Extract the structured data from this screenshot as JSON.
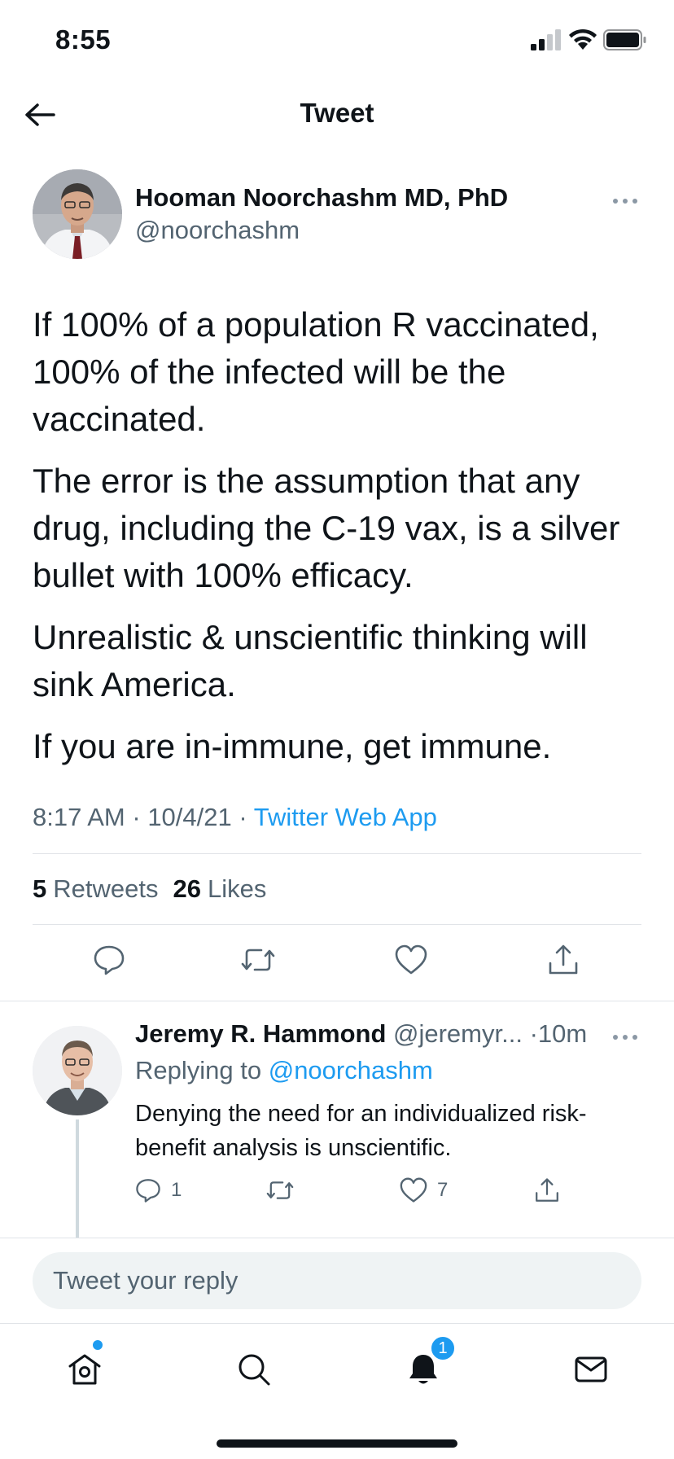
{
  "status_bar": {
    "time": "8:55"
  },
  "nav": {
    "title": "Tweet"
  },
  "tweet": {
    "author_name": "Hooman Noorchashm MD, PhD",
    "author_handle": "@noorchashm",
    "paragraphs": [
      "If 100% of a population R vaccinated, 100% of the infected will be the vaccinated.",
      "The error is the assumption that any drug, including the C-19 vax, is a silver bullet with 100% efficacy.",
      "Unrealistic & unscientific thinking will sink America.",
      "If you are in-immune, get immune."
    ],
    "time": "8:17 AM",
    "date": "10/4/21",
    "source": "Twitter Web App",
    "retweets_count": "5",
    "retweets_label": "Retweets",
    "likes_count": "26",
    "likes_label": "Likes"
  },
  "reply": {
    "name": "Jeremy R. Hammond",
    "handle": "@jeremyr...",
    "time": "10m",
    "replying_prefix": "Replying to",
    "replying_handle": "@noorchashm",
    "text": "Denying the need for an individualized risk-benefit analysis is unscientific.",
    "reply_count": "1",
    "like_count": "7"
  },
  "reply_box": {
    "placeholder": "Tweet your reply"
  },
  "tab_bar": {
    "notifications_badge": "1"
  },
  "colors": {
    "accent": "#1d9bf0",
    "secondary_text": "#536471",
    "primary_text": "#0f1419"
  }
}
